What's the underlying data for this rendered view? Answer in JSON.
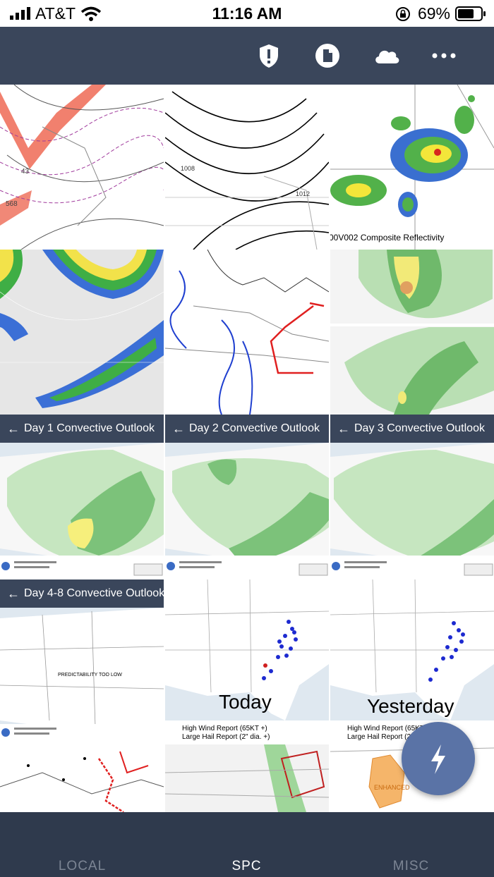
{
  "status_bar": {
    "carrier": "AT&T",
    "time": "11:16 AM",
    "battery": "69%"
  },
  "toolbar": {
    "icons": [
      "shield-alert-icon",
      "document-icon",
      "cloud-icon",
      "more-icon"
    ]
  },
  "tiles": {
    "reflectivity_caption": "00V002 Composite Reflectivity",
    "day1": "Day 1 Convective Outlook",
    "day2": "Day 2 Convective Outlook",
    "day3": "Day 3 Convective Outlook",
    "day48": "Day 4-8 Convective Outlook",
    "day48_note": "PREDICTABILITY TOO LOW",
    "today": "Today",
    "yesterday": "Yesterday",
    "legend_wind": "High Wind Report (65KT +)",
    "legend_hail": "Large Hail Report (2\" dia. +)",
    "legend_wind_yesterday": "High Wind Report (65KT",
    "legend_hail_yesterday": "Large Hail Report (2\"",
    "enhanced_label": "ENHANCED"
  },
  "bottom_nav": {
    "local": "LOCAL",
    "spc": "SPC",
    "misc": "MISC"
  },
  "colors": {
    "bar": "#3a465b",
    "fab": "#5a73a6",
    "marginal": "#c6e6c0",
    "slight": "#7cc27a",
    "enhanced": "#f6ef7c"
  }
}
